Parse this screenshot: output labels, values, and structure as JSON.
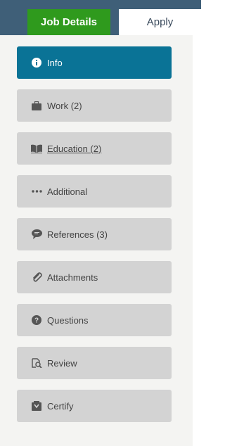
{
  "tabs": {
    "job_details": "Job Details",
    "apply": "Apply"
  },
  "steps": [
    {
      "label": "Info",
      "icon": "info-icon",
      "active": true
    },
    {
      "label": "Work (2)",
      "icon": "briefcase-icon"
    },
    {
      "label": " Education (2)",
      "icon": "book-icon"
    },
    {
      "label": "Additional",
      "icon": "ellipsis-icon"
    },
    {
      "label": "References (3)",
      "icon": "speech-bubble-icon"
    },
    {
      "label": "Attachments",
      "icon": "paperclip-icon"
    },
    {
      "label": "Questions",
      "icon": "question-icon"
    },
    {
      "label": "Review",
      "icon": "review-icon"
    },
    {
      "label": "Certify",
      "icon": "certify-icon"
    }
  ],
  "colors": {
    "header": "#3f5f78",
    "job_tab": "#2f9a1d",
    "active_step": "#0a7396",
    "step": "#d3d3d3",
    "panel": "#f4f4f2"
  }
}
